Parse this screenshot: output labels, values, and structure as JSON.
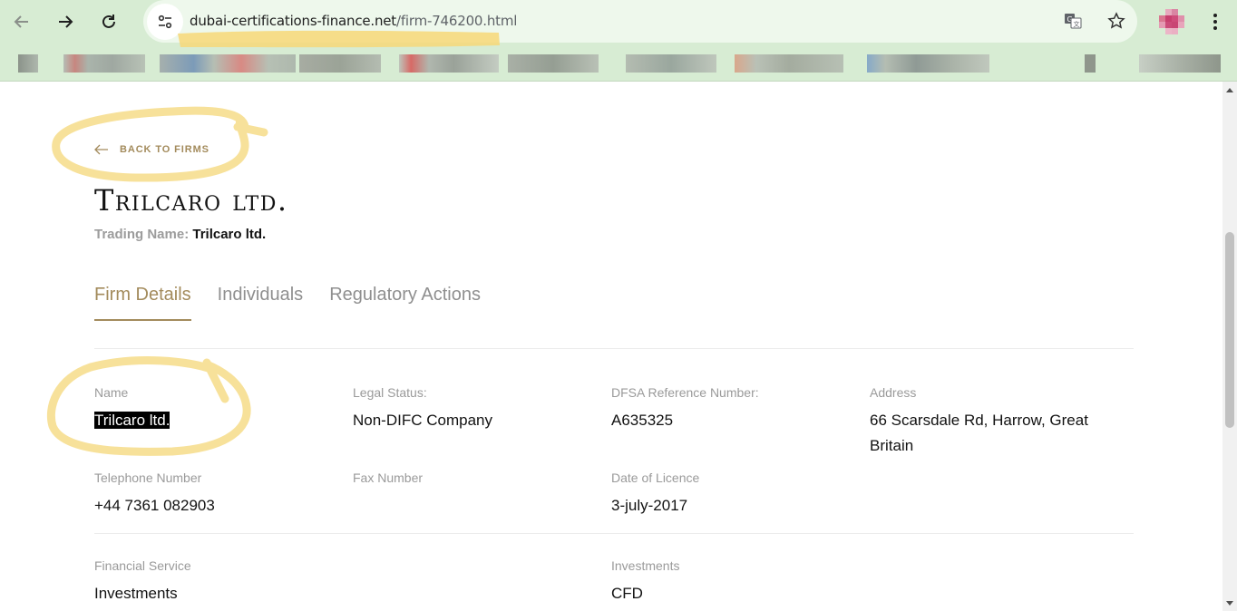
{
  "browser": {
    "url_domain": "dubai-certifications-finance.net",
    "url_path": "/firm-746200.html",
    "icons": [
      "back-icon",
      "forward-icon",
      "reload-icon",
      "site-info-icon",
      "translate-icon",
      "star-icon",
      "profile-avatar",
      "kebab-menu-icon"
    ]
  },
  "page": {
    "back_link": "BACK TO FIRMS",
    "firm_title": "Trilcaro ltd.",
    "trading_label": "Trading Name:",
    "trading_value": "Trilcaro ltd.",
    "tabs": [
      "Firm Details",
      "Individuals",
      "Regulatory Actions"
    ],
    "active_tab": "Firm Details"
  },
  "details": {
    "name": {
      "label": "Name",
      "value": "Trilcaro ltd."
    },
    "legal_status": {
      "label": "Legal Status:",
      "value": "Non-DIFC Company"
    },
    "dfsa_ref": {
      "label": "DFSA Reference Number:",
      "value": "A635325"
    },
    "address": {
      "label": "Address",
      "value": "66 Scarsdale Rd, Harrow, Great Britain"
    },
    "telephone": {
      "label": "Telephone Number",
      "value": "+44 7361 082903"
    },
    "fax": {
      "label": "Fax Number",
      "value": ""
    },
    "licence_date": {
      "label": "Date of Licence",
      "value": "3-july-2017"
    },
    "financial_service": {
      "label": "Financial Service",
      "value": "Investments"
    },
    "investments": {
      "label": "Investments",
      "value": "CFD"
    }
  },
  "colors": {
    "accent_gold": "#a38b5c",
    "browser_bar": "#d7ecd3",
    "annotation_highlight": "#fde68a"
  }
}
